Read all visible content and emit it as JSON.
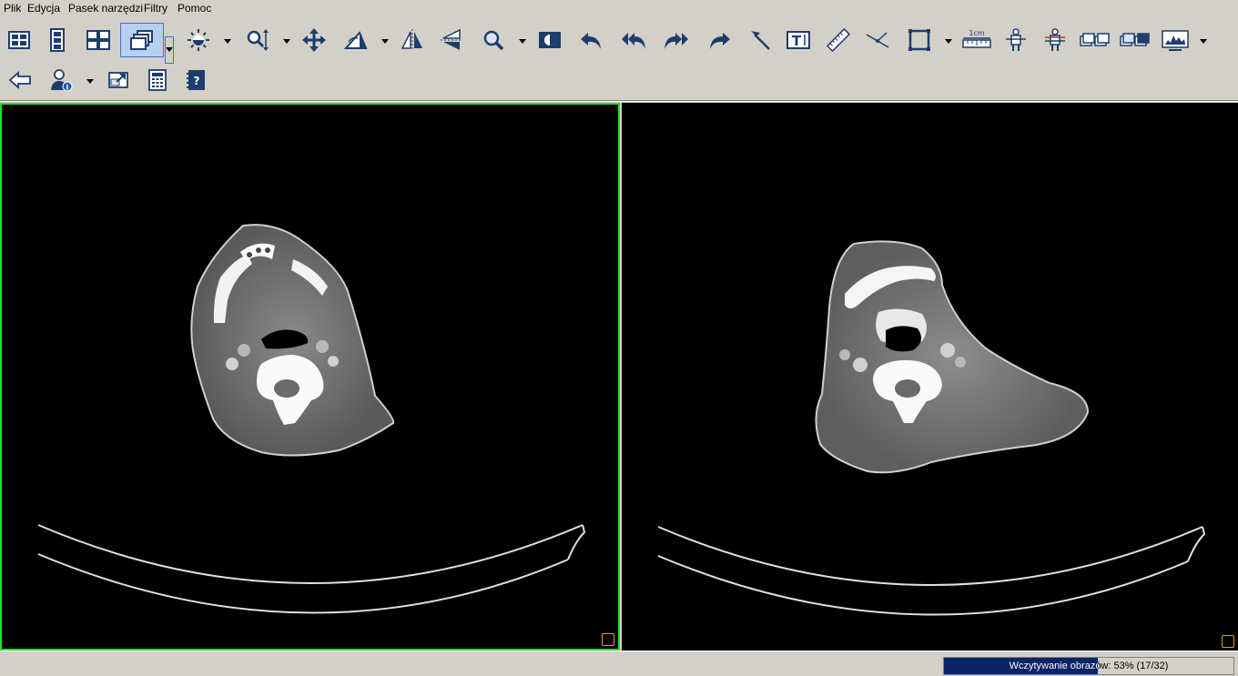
{
  "menu": {
    "items": [
      "Plik",
      "Edycja",
      "Pasek narzędzi",
      "Filtry",
      "Pomoc"
    ]
  },
  "toolbar": {
    "tools": [
      "layout-list-icon",
      "filmstrip-icon",
      "grid-layout-icon",
      "stack-windows-icon",
      "brightness-icon",
      "zoom-icon",
      "pan-icon",
      "rotate-icon",
      "flip-horizontal-icon",
      "flip-vertical-icon",
      "magnifier-icon",
      "invert-icon",
      "undo-icon",
      "undo-all-icon",
      "redo-all-icon",
      "redo-icon",
      "pointer-arrow-icon",
      "text-annotation-icon",
      "ruler-icon",
      "angle-icon",
      "rectangle-icon",
      "scale-1cm-icon",
      "body-orientation-icon",
      "body-reference-icon",
      "series-sync-icon",
      "series-link-icon",
      "histogram-monitor-icon",
      "back-arrow-icon",
      "patient-info-icon",
      "external-window-icon",
      "calculator-icon",
      "help-icon"
    ],
    "scale_label": "1cm",
    "text_tool_label": "T",
    "help_label": "?"
  },
  "status": {
    "progress_label": "Wczytywanie obrazów: 53% (17/32)",
    "progress_fraction": 0.53,
    "loaded": 17,
    "total": 32
  },
  "colors": {
    "active_viewport_border": "#22dd22",
    "progress_fill": "#0a246a",
    "corner_marker": "#e8a000"
  }
}
